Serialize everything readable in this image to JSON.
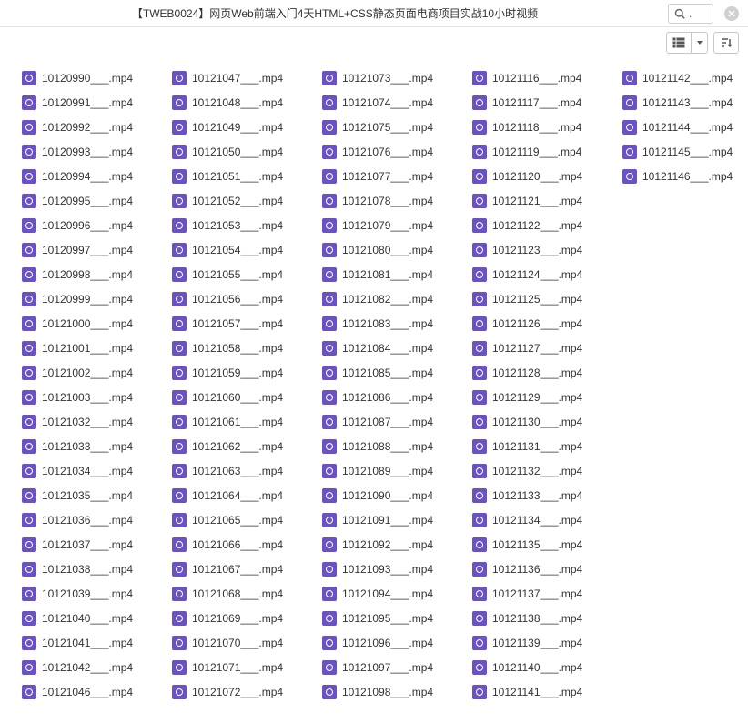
{
  "breadcrumb": "【TWEB0024】网页Web前端入门4天HTML+CSS静态页面电商项目实战10小时视频",
  "search": {
    "placeholder": "."
  },
  "files": [
    "10120990___.mp4",
    "10120991___.mp4",
    "10120992___.mp4",
    "10120993___.mp4",
    "10120994___.mp4",
    "10120995___.mp4",
    "10120996___.mp4",
    "10120997___.mp4",
    "10120998___.mp4",
    "10120999___.mp4",
    "10121000___.mp4",
    "10121001___.mp4",
    "10121002___.mp4",
    "10121003___.mp4",
    "10121032___.mp4",
    "10121033___.mp4",
    "10121034___.mp4",
    "10121035___.mp4",
    "10121036___.mp4",
    "10121037___.mp4",
    "10121038___.mp4",
    "10121039___.mp4",
    "10121040___.mp4",
    "10121041___.mp4",
    "10121042___.mp4",
    "10121046___.mp4",
    "10121047___.mp4",
    "10121048___.mp4",
    "10121049___.mp4",
    "10121050___.mp4",
    "10121051___.mp4",
    "10121052___.mp4",
    "10121053___.mp4",
    "10121054___.mp4",
    "10121055___.mp4",
    "10121056___.mp4",
    "10121057___.mp4",
    "10121058___.mp4",
    "10121059___.mp4",
    "10121060___.mp4",
    "10121061___.mp4",
    "10121062___.mp4",
    "10121063___.mp4",
    "10121064___.mp4",
    "10121065___.mp4",
    "10121066___.mp4",
    "10121067___.mp4",
    "10121068___.mp4",
    "10121069___.mp4",
    "10121070___.mp4",
    "10121071___.mp4",
    "10121072___.mp4",
    "10121073___.mp4",
    "10121074___.mp4",
    "10121075___.mp4",
    "10121076___.mp4",
    "10121077___.mp4",
    "10121078___.mp4",
    "10121079___.mp4",
    "10121080___.mp4",
    "10121081___.mp4",
    "10121082___.mp4",
    "10121083___.mp4",
    "10121084___.mp4",
    "10121085___.mp4",
    "10121086___.mp4",
    "10121087___.mp4",
    "10121088___.mp4",
    "10121089___.mp4",
    "10121090___.mp4",
    "10121091___.mp4",
    "10121092___.mp4",
    "10121093___.mp4",
    "10121094___.mp4",
    "10121095___.mp4",
    "10121096___.mp4",
    "10121097___.mp4",
    "10121098___.mp4",
    "10121116___.mp4",
    "10121117___.mp4",
    "10121118___.mp4",
    "10121119___.mp4",
    "10121120___.mp4",
    "10121121___.mp4",
    "10121122___.mp4",
    "10121123___.mp4",
    "10121124___.mp4",
    "10121125___.mp4",
    "10121126___.mp4",
    "10121127___.mp4",
    "10121128___.mp4",
    "10121129___.mp4",
    "10121130___.mp4",
    "10121131___.mp4",
    "10121132___.mp4",
    "10121133___.mp4",
    "10121134___.mp4",
    "10121135___.mp4",
    "10121136___.mp4",
    "10121137___.mp4",
    "10121138___.mp4",
    "10121139___.mp4",
    "10121140___.mp4",
    "10121141___.mp4",
    "10121142___.mp4",
    "10121143___.mp4",
    "10121144___.mp4",
    "10121145___.mp4",
    "10121146___.mp4"
  ]
}
